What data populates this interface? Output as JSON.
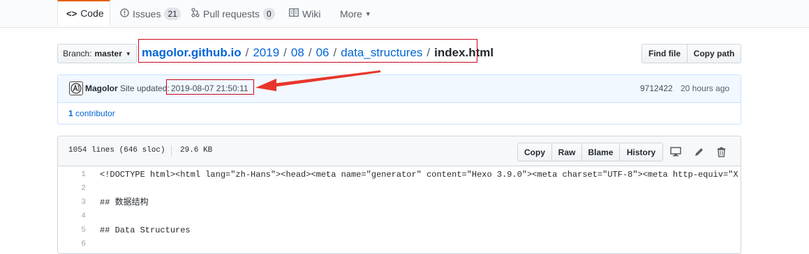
{
  "tabs": [
    {
      "label": "Code",
      "icon": "code-icon",
      "selected": true
    },
    {
      "label": "Issues",
      "icon": "issue-icon",
      "count": "21"
    },
    {
      "label": "Pull requests",
      "icon": "pull-request-icon",
      "count": "0"
    },
    {
      "label": "Wiki",
      "icon": "book-icon"
    },
    {
      "label": "More",
      "icon": "caret-down-icon"
    }
  ],
  "branch": {
    "prefix": "Branch:",
    "name": "master"
  },
  "breadcrumb": {
    "parts": [
      "magolor.github.io",
      "2019",
      "08",
      "06",
      "data_structures"
    ],
    "final": "index.html",
    "separator": "/"
  },
  "actions": {
    "find_file": "Find file",
    "copy_path": "Copy path"
  },
  "commit": {
    "author": "Magolor",
    "message": "Site updated:",
    "timestamp": "2019-08-07 21:50:11",
    "sha": "9712422",
    "age": "20 hours ago",
    "contributors_count": "1",
    "contributors_label": "contributor"
  },
  "file": {
    "lines_info": "1054 lines (646 sloc)",
    "size": "29.6 KB",
    "buttons": [
      "Copy",
      "Raw",
      "Blame",
      "History"
    ],
    "lines": [
      {
        "n": "1",
        "text": "<!DOCTYPE html><html lang=\"zh-Hans\"><head><meta name=\"generator\" content=\"Hexo 3.9.0\"><meta charset=\"UTF-8\"><meta http-equiv=\"X-UA-Compatib"
      },
      {
        "n": "2",
        "text": ""
      },
      {
        "n": "3",
        "text": "## 数据结构"
      },
      {
        "n": "4",
        "text": ""
      },
      {
        "n": "5",
        "text": "## Data Structures"
      },
      {
        "n": "6",
        "text": ""
      }
    ]
  },
  "colors": {
    "accent_tab": "#e36209",
    "link": "#0366d6",
    "annotation": "#d0021b",
    "commit_bg": "#f1f8ff"
  }
}
